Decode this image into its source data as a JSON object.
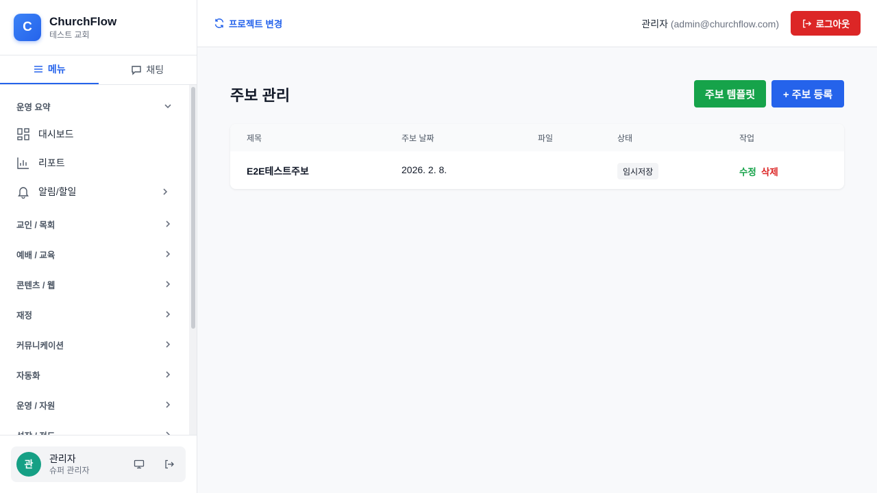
{
  "brand": {
    "logo_letter": "C",
    "name": "ChurchFlow",
    "subtitle": "테스트 교회"
  },
  "side_tabs": [
    {
      "label": "메뉴",
      "icon": "menu-lines-icon",
      "active": true
    },
    {
      "label": "채팅",
      "icon": "chat-bubble-icon",
      "active": false
    }
  ],
  "sidebar": {
    "group_summary": "운영 요약",
    "items": [
      {
        "label": "대시보드",
        "icon": "dashboard-grid-icon"
      },
      {
        "label": "리포트",
        "icon": "bar-chart-icon"
      },
      {
        "label": "알림/할일",
        "icon": "bell-icon"
      }
    ],
    "groups": [
      "교인 / 목회",
      "예배 / 교육",
      "콘텐츠 / 웹",
      "재정",
      "커뮤니케이션",
      "자동화",
      "운영 / 자원",
      "성장 / 전도"
    ]
  },
  "user": {
    "avatar_letter": "관",
    "name": "관리자",
    "role": "슈퍼 관리자"
  },
  "header": {
    "project_change": "프로젝트 변경",
    "admin_name": "관리자",
    "admin_email": "(admin@churchflow.com)",
    "logout": "로그아웃"
  },
  "main": {
    "title": "주보 관리",
    "btn_template": "주보 템플릿",
    "btn_register": "+ 주보 등록",
    "columns": [
      "제목",
      "주보 날짜",
      "파일",
      "상태",
      "작업"
    ],
    "rows": [
      {
        "title": "E2E테스트주보",
        "date": "2026. 2. 8.",
        "file": "",
        "status": "임시저장",
        "edit": "수정",
        "delete": "삭제"
      }
    ]
  },
  "colors": {
    "primary": "#2563eb",
    "success": "#16a34a",
    "danger": "#dc2626"
  }
}
